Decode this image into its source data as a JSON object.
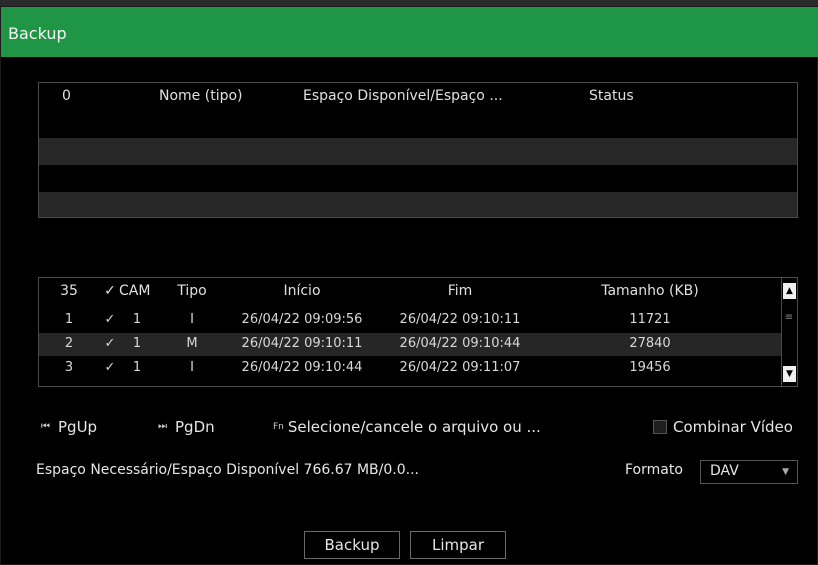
{
  "window": {
    "title": "Backup"
  },
  "device_table": {
    "headers": {
      "index": "0",
      "name": "Nome (tipo)",
      "space": "Espaço Disponível/Espaço ...",
      "status": "Status"
    }
  },
  "file_table": {
    "headers": {
      "count": "35",
      "check": "✓",
      "cam": "CAM",
      "tipo": "Tipo",
      "inicio": "Início",
      "fim": "Fim",
      "tamanho": "Tamanho (KB)"
    },
    "rows": [
      {
        "index": "1",
        "checked": "✓",
        "cam": "1",
        "tipo": "I",
        "inicio": "26/04/22 09:09:56",
        "fim": "26/04/22 09:10:11",
        "tamanho": "11721"
      },
      {
        "index": "2",
        "checked": "✓",
        "cam": "1",
        "tipo": "M",
        "inicio": "26/04/22 09:10:11",
        "fim": "26/04/22 09:10:44",
        "tamanho": "27840"
      },
      {
        "index": "3",
        "checked": "✓",
        "cam": "1",
        "tipo": "I",
        "inicio": "26/04/22 09:10:44",
        "fim": "26/04/22 09:11:07",
        "tamanho": "19456"
      }
    ]
  },
  "actions": {
    "pgup_icon": "⏮",
    "pgup": "PgUp",
    "pgdn_icon": "⏭",
    "pgdn": "PgDn",
    "fn_icon": "Fn",
    "select": "Selecione/cancele o arquivo ou ...",
    "combine": "Combinar Vídeo"
  },
  "space_text": "Espaço Necessário/Espaço Disponível 766.67 MB/0.0...",
  "format": {
    "label": "Formato",
    "value": "DAV"
  },
  "buttons": {
    "backup": "Backup",
    "limpar": "Limpar"
  },
  "colors": {
    "titlebar": "#1f9646",
    "background": "#000000",
    "row_alt": "#272727"
  }
}
